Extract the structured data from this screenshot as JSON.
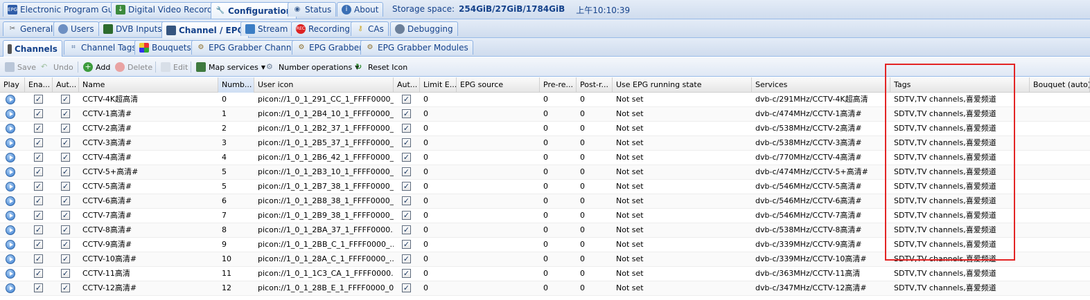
{
  "top_tabs": [
    {
      "label": "Electronic Program Guide",
      "icon": "epg-icon"
    },
    {
      "label": "Digital Video Recorder",
      "icon": "dvr-download-icon"
    },
    {
      "label": "Configuration",
      "icon": "wrench-icon",
      "active": true
    },
    {
      "label": "Status",
      "icon": "eye-icon"
    },
    {
      "label": "About",
      "icon": "info-icon"
    }
  ],
  "storage": {
    "label": "Storage space:",
    "value": "254GiB/27GiB/1784GiB",
    "clock": "上午10:10:39"
  },
  "config_tabs": [
    {
      "label": "General",
      "icon": "tools-icon"
    },
    {
      "label": "Users",
      "icon": "users-icon"
    },
    {
      "label": "DVB Inputs",
      "icon": "dvb-card-icon"
    },
    {
      "label": "Channel / EPG",
      "icon": "tv-icon",
      "active": true
    },
    {
      "label": "Stream",
      "icon": "stream-icon"
    },
    {
      "label": "Recording",
      "icon": "rec-icon"
    },
    {
      "label": "CAs",
      "icon": "key-icon"
    },
    {
      "label": "Debugging",
      "icon": "bug-icon"
    }
  ],
  "channel_tabs": [
    {
      "label": "Channels",
      "icon": "remote-icon",
      "active": true
    },
    {
      "label": "Channel Tags",
      "icon": "tags-icon"
    },
    {
      "label": "Bouquets",
      "icon": "bouquet-icon"
    },
    {
      "label": "EPG Grabber Channels",
      "icon": "grabber-channels-icon"
    },
    {
      "label": "EPG Grabber",
      "icon": "grabber-icon"
    },
    {
      "label": "EPG Grabber Modules",
      "icon": "grabber-modules-icon"
    }
  ],
  "toolbar": {
    "save": "Save",
    "undo": "Undo",
    "add": "Add",
    "delete": "Delete",
    "edit": "Edit",
    "map_services": "Map services",
    "number_operations": "Number operations",
    "reset_icon": "Reset Icon"
  },
  "columns": [
    "Play",
    "Ena...",
    "Aut...",
    "Name",
    "Numb...",
    "User icon",
    "Aut...",
    "Limit E...",
    "EPG source",
    "Pre-re...",
    "Post-r...",
    "Use EPG running state",
    "Services",
    "Tags",
    "Bouquet (auto)"
  ],
  "rows": [
    {
      "name": "CCTV-4K超高清",
      "number": "0",
      "icon": "picon://1_0_1_291_CC_1_FFFF0000_...",
      "limit": "0",
      "pre": "0",
      "post": "0",
      "epg_state": "Not set",
      "service": "dvb-c/291MHz/CCTV-4K超高清",
      "tags": "SDTV,TV channels,喜爱频道"
    },
    {
      "name": "CCTV-1高清#",
      "number": "1",
      "icon": "picon://1_0_1_2B4_10_1_FFFF0000_...",
      "limit": "0",
      "pre": "0",
      "post": "0",
      "epg_state": "Not set",
      "service": "dvb-c/474MHz/CCTV-1高清#",
      "tags": "SDTV,TV channels,喜爱频道"
    },
    {
      "name": "CCTV-2高清#",
      "number": "2",
      "icon": "picon://1_0_1_2B2_37_1_FFFF0000_...",
      "limit": "0",
      "pre": "0",
      "post": "0",
      "epg_state": "Not set",
      "service": "dvb-c/538MHz/CCTV-2高清#",
      "tags": "SDTV,TV channels,喜爱频道"
    },
    {
      "name": "CCTV-3高清#",
      "number": "3",
      "icon": "picon://1_0_1_2B5_37_1_FFFF0000_...",
      "limit": "0",
      "pre": "0",
      "post": "0",
      "epg_state": "Not set",
      "service": "dvb-c/538MHz/CCTV-3高清#",
      "tags": "SDTV,TV channels,喜爱频道"
    },
    {
      "name": "CCTV-4高清#",
      "number": "4",
      "icon": "picon://1_0_1_2B6_42_1_FFFF0000_...",
      "limit": "0",
      "pre": "0",
      "post": "0",
      "epg_state": "Not set",
      "service": "dvb-c/770MHz/CCTV-4高清#",
      "tags": "SDTV,TV channels,喜爱频道"
    },
    {
      "name": "CCTV-5+高清#",
      "number": "5",
      "icon": "picon://1_0_1_2B3_10_1_FFFF0000_...",
      "limit": "0",
      "pre": "0",
      "post": "0",
      "epg_state": "Not set",
      "service": "dvb-c/474MHz/CCTV-5+高清#",
      "tags": "SDTV,TV channels,喜爱频道"
    },
    {
      "name": "CCTV-5高清#",
      "number": "5",
      "icon": "picon://1_0_1_2B7_38_1_FFFF0000_...",
      "limit": "0",
      "pre": "0",
      "post": "0",
      "epg_state": "Not set",
      "service": "dvb-c/546MHz/CCTV-5高清#",
      "tags": "SDTV,TV channels,喜爱频道"
    },
    {
      "name": "CCTV-6高清#",
      "number": "6",
      "icon": "picon://1_0_1_2B8_38_1_FFFF0000_...",
      "limit": "0",
      "pre": "0",
      "post": "0",
      "epg_state": "Not set",
      "service": "dvb-c/546MHz/CCTV-6高清#",
      "tags": "SDTV,TV channels,喜爱频道"
    },
    {
      "name": "CCTV-7高清#",
      "number": "7",
      "icon": "picon://1_0_1_2B9_38_1_FFFF0000_...",
      "limit": "0",
      "pre": "0",
      "post": "0",
      "epg_state": "Not set",
      "service": "dvb-c/546MHz/CCTV-7高清#",
      "tags": "SDTV,TV channels,喜爱频道"
    },
    {
      "name": "CCTV-8高清#",
      "number": "8",
      "icon": "picon://1_0_1_2BA_37_1_FFFF0000...",
      "limit": "0",
      "pre": "0",
      "post": "0",
      "epg_state": "Not set",
      "service": "dvb-c/538MHz/CCTV-8高清#",
      "tags": "SDTV,TV channels,喜爱频道"
    },
    {
      "name": "CCTV-9高清#",
      "number": "9",
      "icon": "picon://1_0_1_2BB_C_1_FFFF0000_...",
      "limit": "0",
      "pre": "0",
      "post": "0",
      "epg_state": "Not set",
      "service": "dvb-c/339MHz/CCTV-9高清#",
      "tags": "SDTV,TV channels,喜爱频道"
    },
    {
      "name": "CCTV-10高清#",
      "number": "10",
      "icon": "picon://1_0_1_28A_C_1_FFFF0000_...",
      "limit": "0",
      "pre": "0",
      "post": "0",
      "epg_state": "Not set",
      "service": "dvb-c/339MHz/CCTV-10高清#",
      "tags": "SDTV,TV channels,喜爱频道"
    },
    {
      "name": "CCTV-11高清",
      "number": "11",
      "icon": "picon://1_0_1_1C3_CA_1_FFFF0000...",
      "limit": "0",
      "pre": "0",
      "post": "0",
      "epg_state": "Not set",
      "service": "dvb-c/363MHz/CCTV-11高清",
      "tags": "SDTV,TV channels,喜爱频道"
    },
    {
      "name": "CCTV-12高清#",
      "number": "12",
      "icon": "picon://1_0_1_28B_E_1_FFFF0000_0...",
      "limit": "0",
      "pre": "0",
      "post": "0",
      "epg_state": "Not set",
      "service": "dvb-c/347MHz/CCTV-12高清#",
      "tags": "SDTV,TV channels,喜爱频道"
    }
  ],
  "colors": {
    "highlight": "#e32424",
    "tab_text": "#15428b",
    "header_border": "#99bbe8"
  }
}
